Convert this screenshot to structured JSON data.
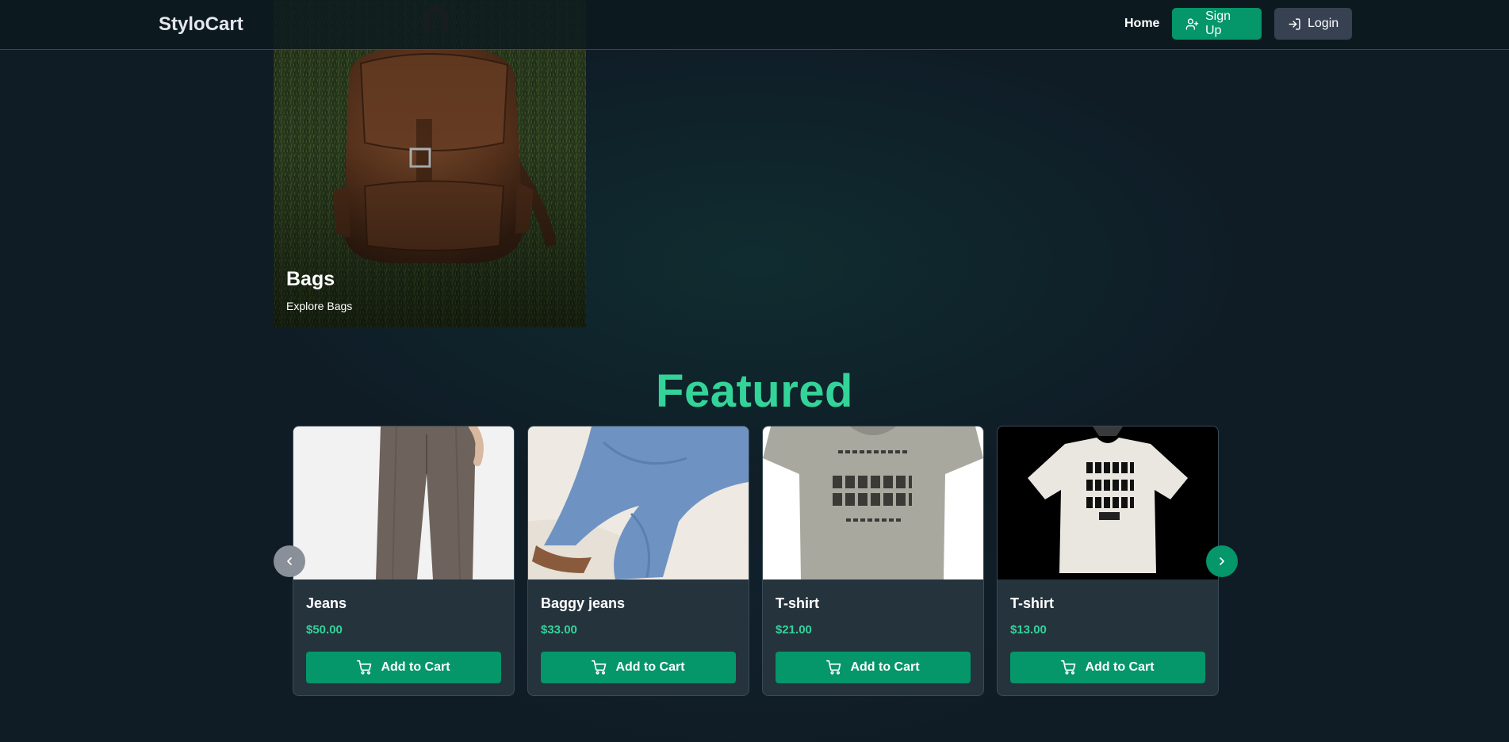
{
  "navbar": {
    "brand": "StyloCart",
    "home_label": "Home",
    "signup_label": "Sign Up",
    "login_label": "Login"
  },
  "category": {
    "title": "Bags",
    "link_label": "Explore Bags"
  },
  "featured": {
    "heading": "Featured",
    "products": [
      {
        "name": "Jeans",
        "price": "$50.00",
        "button_label": "Add to Cart"
      },
      {
        "name": "Baggy jeans",
        "price": "$33.00",
        "button_label": "Add to Cart"
      },
      {
        "name": "T-shirt",
        "price": "$21.00",
        "button_label": "Add to Cart"
      },
      {
        "name": "T-shirt",
        "price": "$13.00",
        "button_label": "Add to Cart"
      }
    ]
  },
  "colors": {
    "accent": "#34d399",
    "primary_button": "#059669",
    "secondary_button": "#374151",
    "background": "#0f1c26"
  },
  "icons": {
    "signup": "user-plus-icon",
    "login": "login-icon",
    "cart": "cart-icon",
    "prev": "chevron-left-icon",
    "next": "chevron-right-icon"
  }
}
